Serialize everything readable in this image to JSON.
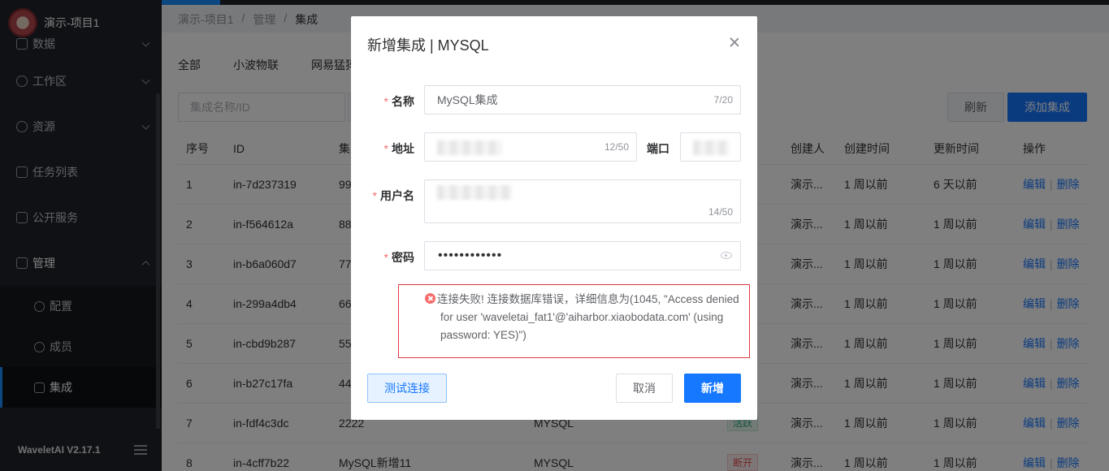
{
  "app": {
    "project": "演示-项目1",
    "version": "WaveletAI V2.17.1"
  },
  "sidebar": {
    "items": [
      {
        "label": "数据"
      },
      {
        "label": "工作区"
      },
      {
        "label": "资源"
      },
      {
        "label": "任务列表"
      },
      {
        "label": "公开服务"
      },
      {
        "label": "管理"
      }
    ],
    "subitems": [
      {
        "label": "配置"
      },
      {
        "label": "成员"
      },
      {
        "label": "集成"
      }
    ]
  },
  "breadcrumb": [
    "演示-项目1",
    "/",
    "管理",
    "/",
    "集成"
  ],
  "filter_tabs": [
    "全部",
    "小波物联",
    "网易猛犸"
  ],
  "search": {
    "placeholder": "集成名称/ID"
  },
  "buttons": {
    "refresh": "刷新",
    "add": "添加集成"
  },
  "table": {
    "headers": [
      "序号",
      "ID",
      "集",
      "",
      "",
      "",
      "创建人",
      "创建时间",
      "更新时间",
      "操作"
    ],
    "rows": [
      {
        "no": "1",
        "id": "in-7d237319",
        "name": "99",
        "type": "",
        "status": "",
        "status_kind": "on",
        "creator": "演示...",
        "created": "1 周以前",
        "updated": "6 天以前"
      },
      {
        "no": "2",
        "id": "in-f564612a",
        "name": "88",
        "type": "",
        "status": "",
        "status_kind": "on",
        "creator": "演示...",
        "created": "1 周以前",
        "updated": "1 周以前"
      },
      {
        "no": "3",
        "id": "in-b6a060d7",
        "name": "77",
        "type": "",
        "status": "",
        "status_kind": "on",
        "creator": "演示...",
        "created": "1 周以前",
        "updated": "1 周以前"
      },
      {
        "no": "4",
        "id": "in-299a4db4",
        "name": "66",
        "type": "",
        "status": "",
        "status_kind": "off",
        "creator": "演示...",
        "created": "1 周以前",
        "updated": "1 周以前"
      },
      {
        "no": "5",
        "id": "in-cbd9b287",
        "name": "55",
        "type": "",
        "status": "",
        "status_kind": "on",
        "creator": "演示...",
        "created": "1 周以前",
        "updated": "1 周以前"
      },
      {
        "no": "6",
        "id": "in-b27c17fa",
        "name": "44",
        "type": "",
        "status": "",
        "status_kind": "off",
        "creator": "演示...",
        "created": "1 周以前",
        "updated": "1 周以前"
      },
      {
        "no": "7",
        "id": "in-fdf4c3dc",
        "name": "2222",
        "type": "MYSQL",
        "status": "活跃",
        "status_kind": "on",
        "creator": "演示...",
        "created": "1 周以前",
        "updated": "1 周以前"
      },
      {
        "no": "8",
        "id": "in-4cff7b22",
        "name": "MySQL新增11",
        "type": "MYSQL",
        "status": "断开",
        "status_kind": "off",
        "creator": "演示...",
        "created": "1 周以前",
        "updated": "1 周以前"
      }
    ],
    "op_edit": "编辑",
    "op_sep": "|",
    "op_delete": "删除"
  },
  "dialog": {
    "title": "新增集成 | MYSQL",
    "name_label": "名称",
    "name_value": "MySQL集成",
    "name_count": "7/20",
    "addr_label": "地址",
    "addr_count": "12/50",
    "port_label": "端口",
    "user_label": "用户名",
    "user_count": "14/50",
    "pwd_label": "密码",
    "pwd_value": "••••••••••••",
    "required_mark": "*",
    "error": "连接失败! 连接数据库错误，详细信息为(1045, \"Access denied for user 'waveletai_fat1'@'aiharbor.xiaobodata.com' (using password: YES)\")",
    "btn_test": "测试连接",
    "btn_cancel": "取消",
    "btn_ok": "新增"
  },
  "colors": {
    "primary": "#1677ff",
    "error": "#e0383e",
    "sidebar": "#1f2329"
  }
}
